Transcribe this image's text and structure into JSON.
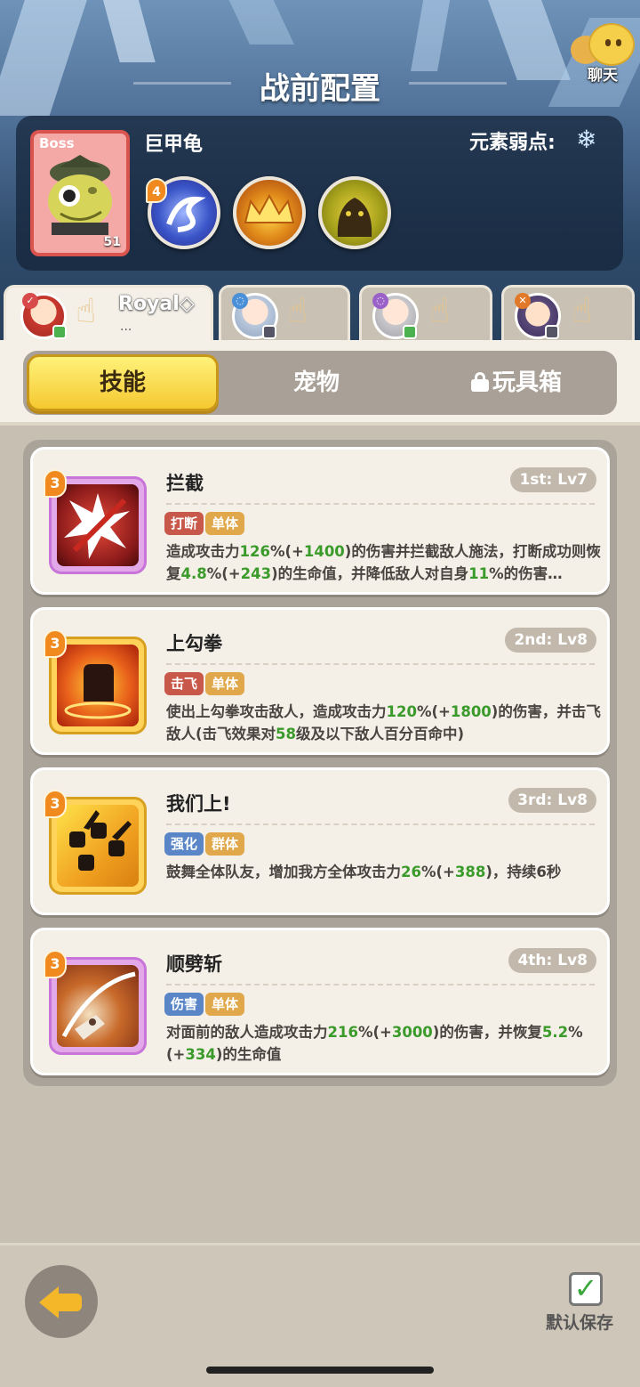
{
  "header": {
    "title": "战前配置",
    "chat_label": "聊天"
  },
  "boss": {
    "tag": "Boss",
    "name": "巨甲龟",
    "level": "51",
    "weakness_label": "元素弱点:",
    "weakness_icon": "snowflake-icon",
    "skill_badge": "4",
    "skills": [
      "swirl-skill-icon",
      "crown-flame-skill-icon",
      "beast-silhouette-skill-icon"
    ]
  },
  "heroes": [
    {
      "name": "Royal",
      "suffix": "◇",
      "dots": "...",
      "active": true
    },
    {
      "name": "",
      "active": false
    },
    {
      "name": "",
      "active": false
    },
    {
      "name": "",
      "active": false
    }
  ],
  "tabs": {
    "skills": "技能",
    "pets": "宠物",
    "toybox": "玩具箱"
  },
  "skills": [
    {
      "name": "拦截",
      "rank": "1st: Lv7",
      "level_badge": "3",
      "tags": [
        "打断",
        "单体"
      ],
      "desc": [
        {
          "t": "造成攻击力"
        },
        {
          "t": "126",
          "h": true
        },
        {
          "t": "%(+"
        },
        {
          "t": "1400",
          "h": true
        },
        {
          "t": ")的伤害并拦截敌人施法，打断成功则恢复"
        },
        {
          "t": "4.8",
          "h": true
        },
        {
          "t": "%(+"
        },
        {
          "t": "243",
          "h": true
        },
        {
          "t": ")的生命值，并降低敌人对自身"
        },
        {
          "t": "11",
          "h": true
        },
        {
          "t": "%的伤害…"
        }
      ]
    },
    {
      "name": "上勾拳",
      "rank": "2nd: Lv8",
      "level_badge": "3",
      "tags": [
        "击飞",
        "单体"
      ],
      "desc": [
        {
          "t": "使出上勾拳攻击敌人，造成攻击力"
        },
        {
          "t": "120",
          "h": true
        },
        {
          "t": "%(+"
        },
        {
          "t": "1800",
          "h": true
        },
        {
          "t": ")的伤害，并击飞敌人(击飞效果对"
        },
        {
          "t": "58",
          "h": true
        },
        {
          "t": "级及以下敌人百分百命中)"
        }
      ]
    },
    {
      "name": "我们上!",
      "rank": "3rd: Lv8",
      "level_badge": "3",
      "tags": [
        "强化",
        "群体"
      ],
      "desc": [
        {
          "t": "鼓舞全体队友，增加我方全体攻击力"
        },
        {
          "t": "26",
          "h": true
        },
        {
          "t": "%(+"
        },
        {
          "t": "388",
          "h": true
        },
        {
          "t": ")，持续6秒"
        }
      ]
    },
    {
      "name": "顺劈斩",
      "rank": "4th: Lv8",
      "level_badge": "3",
      "tags": [
        "伤害",
        "单体"
      ],
      "desc": [
        {
          "t": "对面前的敌人造成攻击力"
        },
        {
          "t": "216",
          "h": true
        },
        {
          "t": "%(+"
        },
        {
          "t": "3000",
          "h": true
        },
        {
          "t": ")的伤害，并恢复"
        },
        {
          "t": "5.2",
          "h": true
        },
        {
          "t": "%(+"
        },
        {
          "t": "334",
          "h": true
        },
        {
          "t": ")的生命值"
        }
      ]
    }
  ],
  "footer": {
    "save_label": "默认保存"
  },
  "colors": {
    "highlight": "#3a9a2a",
    "accent_gold": "#f5c830",
    "boss_red": "#d9534f"
  }
}
